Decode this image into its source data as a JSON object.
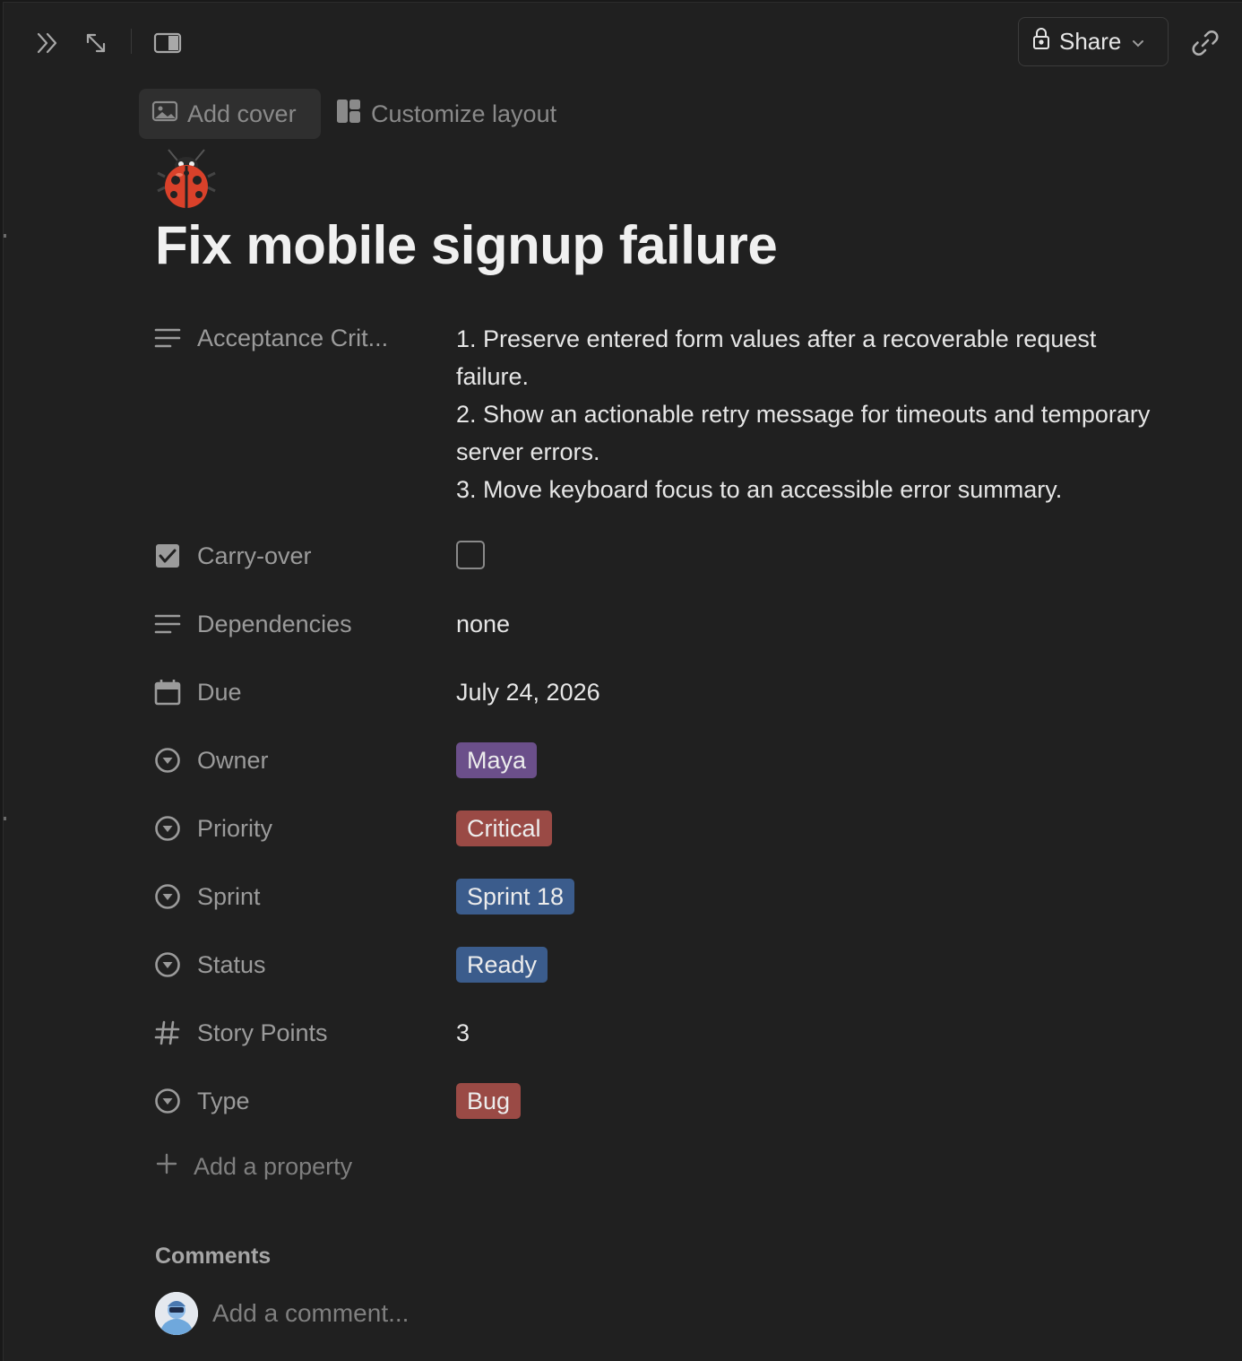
{
  "topbar": {
    "icons": [
      "chevrons-right-icon",
      "expand-icon",
      "side-peek-icon"
    ],
    "share_label": "Share",
    "link_icon": "link-icon"
  },
  "page_actions": {
    "add_cover": "Add cover",
    "customize_layout": "Customize layout"
  },
  "page": {
    "icon": "ladybug-icon",
    "title": "Fix mobile signup failure"
  },
  "properties": {
    "acceptance": {
      "label": "Acceptance Crit...",
      "lines": [
        "1. Preserve entered form values after a recoverable request",
        "failure.",
        "2. Show an actionable retry message for timeouts and temporary",
        "server errors.",
        "3. Move keyboard focus to an accessible error summary."
      ]
    },
    "carry_over": {
      "label": "Carry-over",
      "checked": false
    },
    "dependencies": {
      "label": "Dependencies",
      "value": "none"
    },
    "due": {
      "label": "Due",
      "value": "July 24, 2026"
    },
    "owner": {
      "label": "Owner",
      "value": "Maya",
      "color": "#6b4f8a"
    },
    "priority": {
      "label": "Priority",
      "value": "Critical",
      "color": "#9a4a45"
    },
    "sprint": {
      "label": "Sprint",
      "value": "Sprint 18",
      "color": "#3b5c8c"
    },
    "status": {
      "label": "Status",
      "value": "Ready",
      "color": "#3b5c8c"
    },
    "story_points": {
      "label": "Story Points",
      "value": "3"
    },
    "type": {
      "label": "Type",
      "value": "Bug",
      "color": "#9a4a45"
    }
  },
  "add_property": "Add a property",
  "comments": {
    "heading": "Comments",
    "placeholder": "Add a comment..."
  }
}
